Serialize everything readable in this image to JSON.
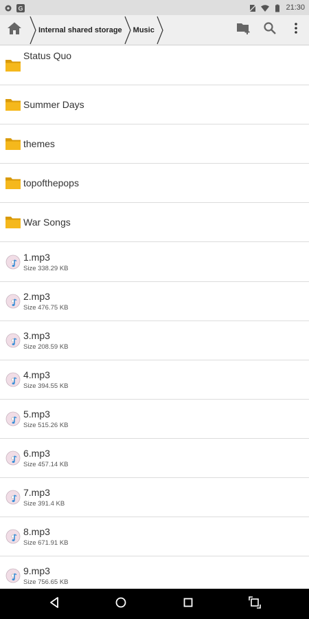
{
  "status_bar": {
    "time": "21:30",
    "left_icons": [
      "settings-gear-icon",
      "google-g-icon"
    ],
    "right_icons": [
      "no-sim-icon",
      "wifi-icon",
      "battery-icon"
    ]
  },
  "toolbar": {
    "breadcrumbs": [
      "Internal shared storage",
      "Music"
    ],
    "actions": [
      "new-folder-icon",
      "search-icon",
      "more-vert-icon"
    ]
  },
  "folders": [
    {
      "name": "Status Quo"
    },
    {
      "name": "Summer Days"
    },
    {
      "name": "themes"
    },
    {
      "name": "topofthepops"
    },
    {
      "name": "War Songs"
    }
  ],
  "files": [
    {
      "name": "1.mp3",
      "size": "Size 338.29 KB"
    },
    {
      "name": "2.mp3",
      "size": "Size 476.75 KB"
    },
    {
      "name": "3.mp3",
      "size": "Size 208.59 KB"
    },
    {
      "name": "4.mp3",
      "size": "Size 394.55 KB"
    },
    {
      "name": "5.mp3",
      "size": "Size 515.26 KB"
    },
    {
      "name": "6.mp3",
      "size": "Size 457.14 KB"
    },
    {
      "name": "7.mp3",
      "size": "Size 391.4 KB"
    },
    {
      "name": "8.mp3",
      "size": "Size 671.91 KB"
    },
    {
      "name": "9.mp3",
      "size": "Size 756.65 KB"
    }
  ],
  "colors": {
    "folder": "#f5b81c",
    "folder_dark": "#d99a0a",
    "toolbar_bg": "#efefef",
    "statusbar_bg": "#dedede",
    "navbar_bg": "#000000"
  }
}
